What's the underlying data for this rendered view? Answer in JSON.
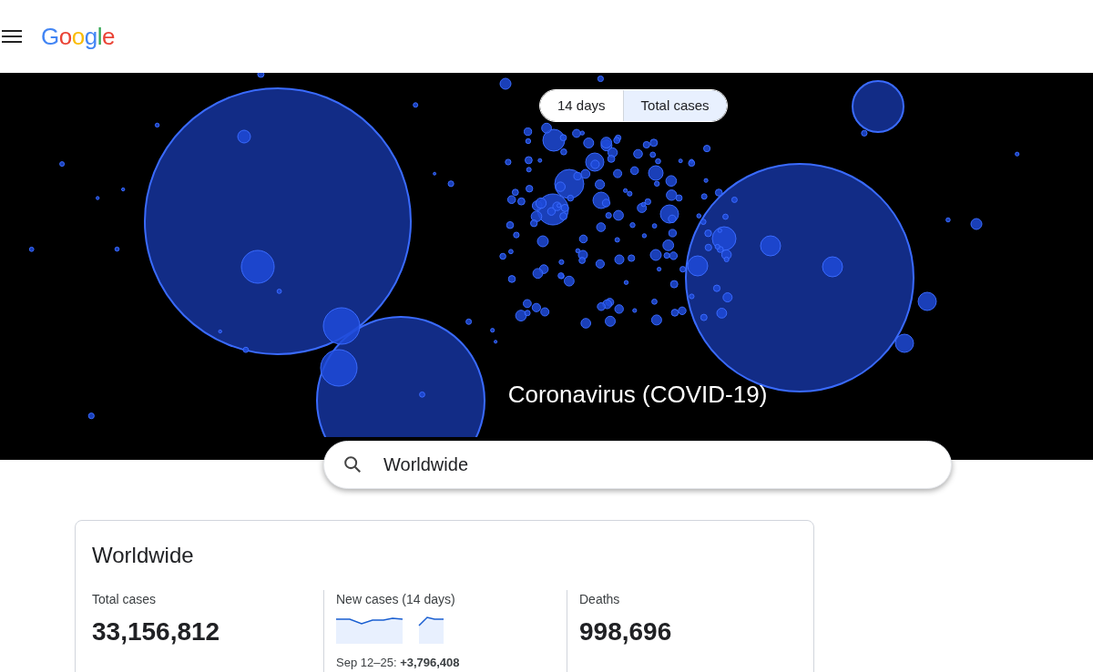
{
  "header": {
    "logo": "Google"
  },
  "map": {
    "tabs": [
      {
        "label": "14 days",
        "selected": false
      },
      {
        "label": "Total cases",
        "selected": true
      }
    ],
    "title": "Coronavirus (COVID-19)"
  },
  "search": {
    "value": "Worldwide"
  },
  "card": {
    "title": "Worldwide",
    "stats": [
      {
        "kind": "number",
        "label": "Total cases",
        "value": "33,156,812"
      },
      {
        "kind": "sparkline",
        "label": "New cases (14 days)",
        "note": "Sep 12–25: **+3,796,408**"
      },
      {
        "kind": "number",
        "label": "Deaths",
        "value": "998,696"
      }
    ]
  }
}
